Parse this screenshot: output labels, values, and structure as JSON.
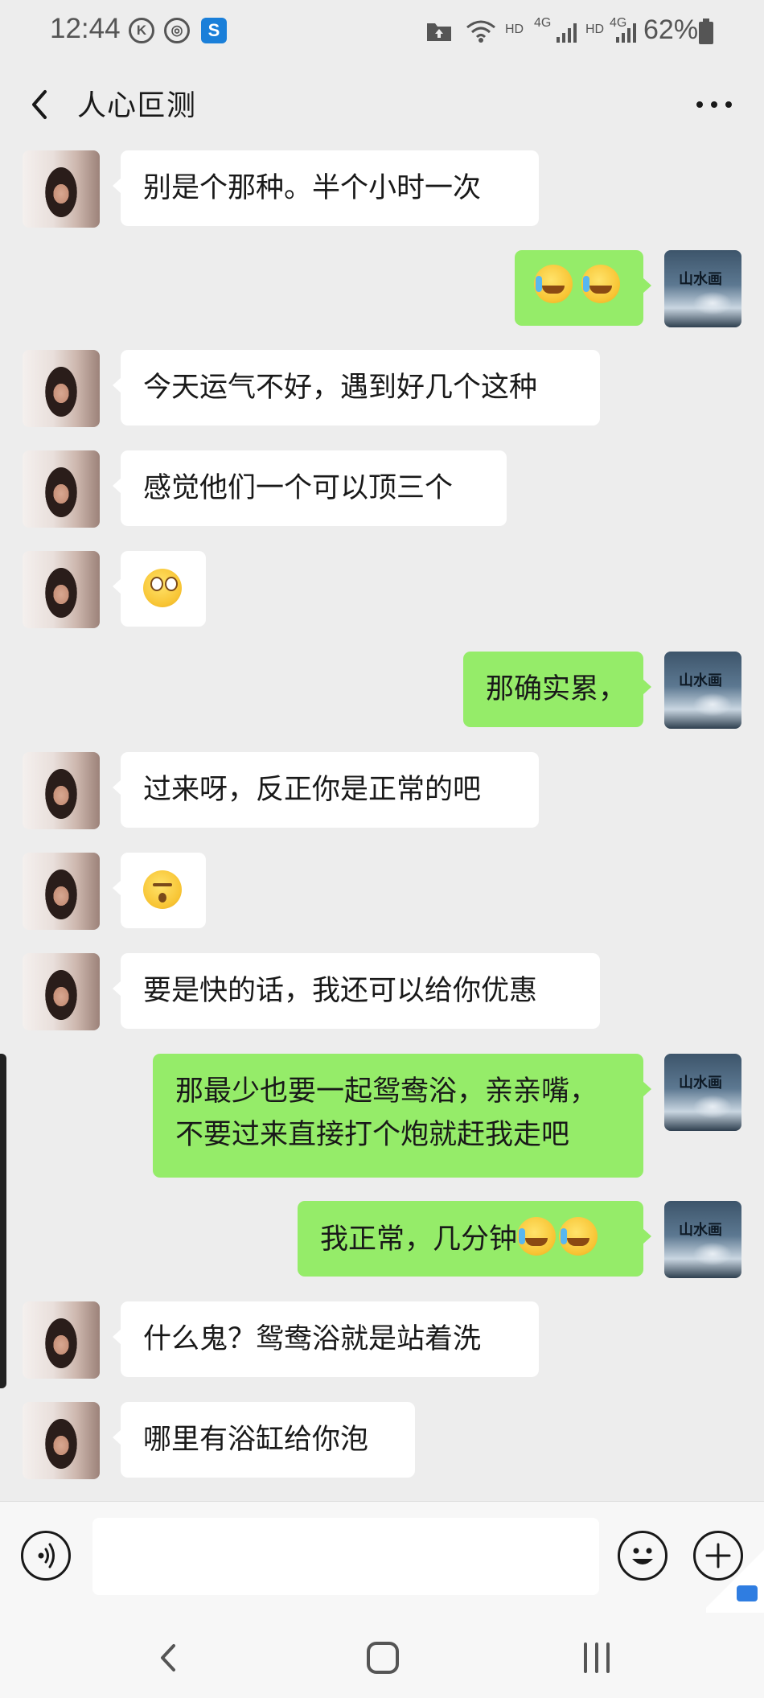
{
  "status_bar": {
    "time": "12:44",
    "left_icons": [
      "k-circle-icon",
      "sync-circle-icon",
      "s-app-icon"
    ],
    "right_icons": [
      "folder-upload-icon",
      "wifi-icon",
      "hd-label",
      "4g-signal-icon",
      "hd-label",
      "4g-signal-icon",
      "battery-icon"
    ],
    "hd": "HD",
    "net": "4G",
    "battery": "62%"
  },
  "header": {
    "title": "人心叵测",
    "back_icon": "chevron-left-icon",
    "more_icon": "more-dots-icon"
  },
  "messages": [
    {
      "from": "other",
      "text": "别是个那种。半个小时一次"
    },
    {
      "from": "me",
      "emoji": [
        "crying-laughing",
        "crying-laughing"
      ]
    },
    {
      "from": "other",
      "text": "今天运气不好，遇到好几个这种"
    },
    {
      "from": "other",
      "text": "感觉他们一个可以顶三个"
    },
    {
      "from": "other",
      "emoji": [
        "rolling-eyes"
      ]
    },
    {
      "from": "me",
      "text": "那确实累，"
    },
    {
      "from": "other",
      "text": "过来呀，反正你是正常的吧"
    },
    {
      "from": "other",
      "emoji": [
        "kiss-face"
      ]
    },
    {
      "from": "other",
      "text": "要是快的话，我还可以给你优惠"
    },
    {
      "from": "me",
      "lines": [
        "那最少也要一起鸳鸯浴，亲亲嘴，",
        "不要过来直接打个炮就赶我走吧"
      ]
    },
    {
      "from": "me",
      "text": "我正常，几分钟",
      "emoji": [
        "crying-laughing",
        "crying-laughing"
      ]
    },
    {
      "from": "other",
      "text": "什么鬼？鸳鸯浴就是站着洗"
    },
    {
      "from": "other",
      "text": "哪里有浴缸给你泡"
    }
  ],
  "my_avatar_text": "山水画",
  "input": {
    "voice_icon": "voice-icon",
    "emoji_icon": "emoji-smile-icon",
    "plus_icon": "plus-icon",
    "value": ""
  },
  "nav": {
    "back_icon": "nav-back-icon",
    "home_icon": "nav-home-icon",
    "recents_icon": "nav-recents-icon"
  },
  "colors": {
    "background": "#ededed",
    "outgoing_bubble": "#95ec69",
    "incoming_bubble": "#ffffff",
    "text": "#191919"
  }
}
